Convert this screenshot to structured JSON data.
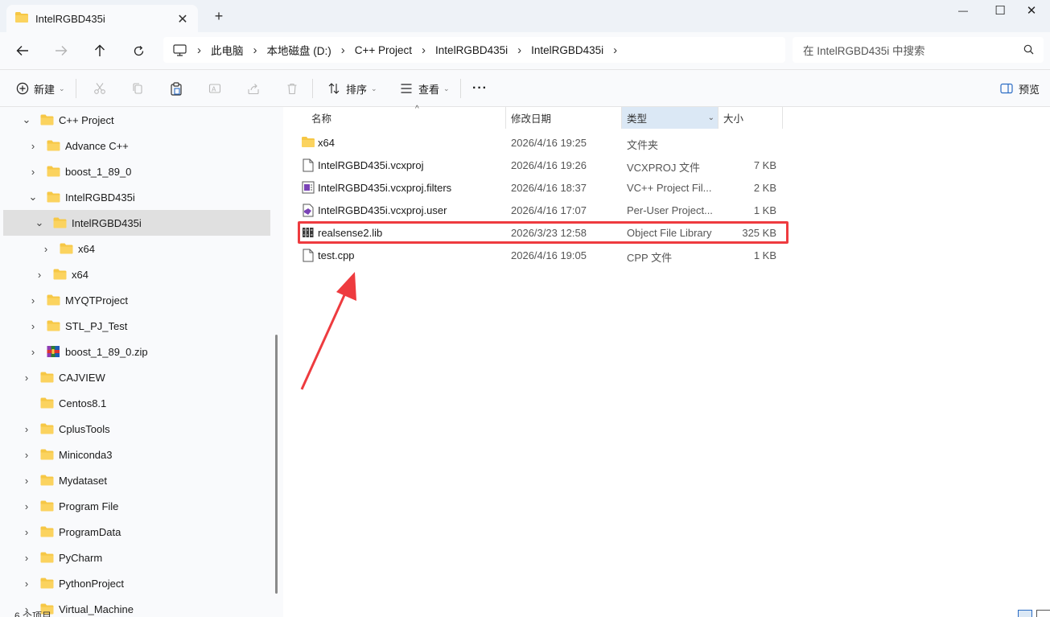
{
  "window": {
    "tab_title": "IntelRGBD435i",
    "close_tab_glyph": "✕",
    "new_tab_glyph": "+",
    "minimize_glyph": "—",
    "maximize_glyph": "☐",
    "close_glyph": "✕"
  },
  "address": {
    "breadcrumb": [
      "此电脑",
      "本地磁盘 (D:)",
      "C++ Project",
      "IntelRGBD435i",
      "IntelRGBD435i"
    ],
    "search_placeholder": "在 IntelRGBD435i 中搜索"
  },
  "commands": {
    "new": "新建",
    "sort": "排序",
    "view": "查看",
    "more": "···",
    "preview": "预览"
  },
  "sidebar": {
    "items": [
      {
        "label": "C++ Project",
        "expanded": true
      },
      {
        "label": "Advance C++"
      },
      {
        "label": "boost_1_89_0"
      },
      {
        "label": "IntelRGBD435i",
        "expanded": true
      },
      {
        "label": "IntelRGBD435i",
        "expanded": true,
        "selected": true
      },
      {
        "label": "x64"
      },
      {
        "label": "x64"
      },
      {
        "label": "MYQTProject"
      },
      {
        "label": "STL_PJ_Test"
      },
      {
        "label": "boost_1_89_0.zip",
        "icon": "zip-archive-icon"
      },
      {
        "label": "CAJVIEW"
      },
      {
        "label": "Centos8.1",
        "no_chevron": true
      },
      {
        "label": "CplusTools"
      },
      {
        "label": "Miniconda3"
      },
      {
        "label": "Mydataset"
      },
      {
        "label": "Program File"
      },
      {
        "label": "ProgramData"
      },
      {
        "label": "PyCharm"
      },
      {
        "label": "PythonProject"
      },
      {
        "label": "Virtual_Machine"
      }
    ]
  },
  "columns": {
    "name": "名称",
    "date": "修改日期",
    "type": "类型",
    "size": "大小"
  },
  "files": [
    {
      "name": "x64",
      "date": "2026/4/16 19:25",
      "type": "文件夹",
      "size": "",
      "icon": "folder-icon"
    },
    {
      "name": "IntelRGBD435i.vcxproj",
      "date": "2026/4/16 19:26",
      "type": "VCXPROJ 文件",
      "size": "7 KB",
      "icon": "file-icon"
    },
    {
      "name": "IntelRGBD435i.vcxproj.filters",
      "date": "2026/4/16 18:37",
      "type": "VC++ Project Fil...",
      "size": "2 KB",
      "icon": "vc-filters-icon"
    },
    {
      "name": "IntelRGBD435i.vcxproj.user",
      "date": "2026/4/16 17:07",
      "type": "Per-User Project...",
      "size": "1 KB",
      "icon": "vc-user-icon"
    },
    {
      "name": "realsense2.lib",
      "date": "2026/3/23 12:58",
      "type": "Object File Library",
      "size": "325 KB",
      "icon": "library-icon"
    },
    {
      "name": "test.cpp",
      "date": "2026/4/16 19:05",
      "type": "CPP 文件",
      "size": "1 KB",
      "icon": "file-icon"
    }
  ],
  "status": {
    "item_count": "6 个项目"
  },
  "colors": {
    "highlight": "#ee3b3f",
    "folder": "#f6c745",
    "selected_row": "#e0e0e0",
    "sorted_header": "#dbe8f5"
  }
}
